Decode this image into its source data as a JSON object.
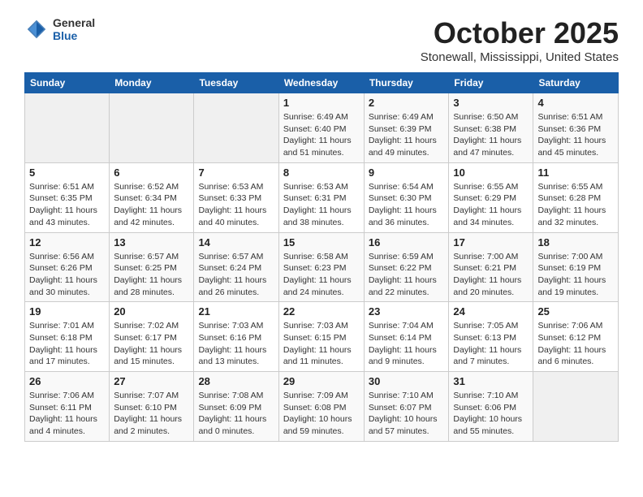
{
  "header": {
    "logo": {
      "general": "General",
      "blue": "Blue"
    },
    "title": "October 2025",
    "location": "Stonewall, Mississippi, United States"
  },
  "weekdays": [
    "Sunday",
    "Monday",
    "Tuesday",
    "Wednesday",
    "Thursday",
    "Friday",
    "Saturday"
  ],
  "weeks": [
    [
      {
        "day": "",
        "info": ""
      },
      {
        "day": "",
        "info": ""
      },
      {
        "day": "",
        "info": ""
      },
      {
        "day": "1",
        "info": "Sunrise: 6:49 AM\nSunset: 6:40 PM\nDaylight: 11 hours and 51 minutes."
      },
      {
        "day": "2",
        "info": "Sunrise: 6:49 AM\nSunset: 6:39 PM\nDaylight: 11 hours and 49 minutes."
      },
      {
        "day": "3",
        "info": "Sunrise: 6:50 AM\nSunset: 6:38 PM\nDaylight: 11 hours and 47 minutes."
      },
      {
        "day": "4",
        "info": "Sunrise: 6:51 AM\nSunset: 6:36 PM\nDaylight: 11 hours and 45 minutes."
      }
    ],
    [
      {
        "day": "5",
        "info": "Sunrise: 6:51 AM\nSunset: 6:35 PM\nDaylight: 11 hours and 43 minutes."
      },
      {
        "day": "6",
        "info": "Sunrise: 6:52 AM\nSunset: 6:34 PM\nDaylight: 11 hours and 42 minutes."
      },
      {
        "day": "7",
        "info": "Sunrise: 6:53 AM\nSunset: 6:33 PM\nDaylight: 11 hours and 40 minutes."
      },
      {
        "day": "8",
        "info": "Sunrise: 6:53 AM\nSunset: 6:31 PM\nDaylight: 11 hours and 38 minutes."
      },
      {
        "day": "9",
        "info": "Sunrise: 6:54 AM\nSunset: 6:30 PM\nDaylight: 11 hours and 36 minutes."
      },
      {
        "day": "10",
        "info": "Sunrise: 6:55 AM\nSunset: 6:29 PM\nDaylight: 11 hours and 34 minutes."
      },
      {
        "day": "11",
        "info": "Sunrise: 6:55 AM\nSunset: 6:28 PM\nDaylight: 11 hours and 32 minutes."
      }
    ],
    [
      {
        "day": "12",
        "info": "Sunrise: 6:56 AM\nSunset: 6:26 PM\nDaylight: 11 hours and 30 minutes."
      },
      {
        "day": "13",
        "info": "Sunrise: 6:57 AM\nSunset: 6:25 PM\nDaylight: 11 hours and 28 minutes."
      },
      {
        "day": "14",
        "info": "Sunrise: 6:57 AM\nSunset: 6:24 PM\nDaylight: 11 hours and 26 minutes."
      },
      {
        "day": "15",
        "info": "Sunrise: 6:58 AM\nSunset: 6:23 PM\nDaylight: 11 hours and 24 minutes."
      },
      {
        "day": "16",
        "info": "Sunrise: 6:59 AM\nSunset: 6:22 PM\nDaylight: 11 hours and 22 minutes."
      },
      {
        "day": "17",
        "info": "Sunrise: 7:00 AM\nSunset: 6:21 PM\nDaylight: 11 hours and 20 minutes."
      },
      {
        "day": "18",
        "info": "Sunrise: 7:00 AM\nSunset: 6:19 PM\nDaylight: 11 hours and 19 minutes."
      }
    ],
    [
      {
        "day": "19",
        "info": "Sunrise: 7:01 AM\nSunset: 6:18 PM\nDaylight: 11 hours and 17 minutes."
      },
      {
        "day": "20",
        "info": "Sunrise: 7:02 AM\nSunset: 6:17 PM\nDaylight: 11 hours and 15 minutes."
      },
      {
        "day": "21",
        "info": "Sunrise: 7:03 AM\nSunset: 6:16 PM\nDaylight: 11 hours and 13 minutes."
      },
      {
        "day": "22",
        "info": "Sunrise: 7:03 AM\nSunset: 6:15 PM\nDaylight: 11 hours and 11 minutes."
      },
      {
        "day": "23",
        "info": "Sunrise: 7:04 AM\nSunset: 6:14 PM\nDaylight: 11 hours and 9 minutes."
      },
      {
        "day": "24",
        "info": "Sunrise: 7:05 AM\nSunset: 6:13 PM\nDaylight: 11 hours and 7 minutes."
      },
      {
        "day": "25",
        "info": "Sunrise: 7:06 AM\nSunset: 6:12 PM\nDaylight: 11 hours and 6 minutes."
      }
    ],
    [
      {
        "day": "26",
        "info": "Sunrise: 7:06 AM\nSunset: 6:11 PM\nDaylight: 11 hours and 4 minutes."
      },
      {
        "day": "27",
        "info": "Sunrise: 7:07 AM\nSunset: 6:10 PM\nDaylight: 11 hours and 2 minutes."
      },
      {
        "day": "28",
        "info": "Sunrise: 7:08 AM\nSunset: 6:09 PM\nDaylight: 11 hours and 0 minutes."
      },
      {
        "day": "29",
        "info": "Sunrise: 7:09 AM\nSunset: 6:08 PM\nDaylight: 10 hours and 59 minutes."
      },
      {
        "day": "30",
        "info": "Sunrise: 7:10 AM\nSunset: 6:07 PM\nDaylight: 10 hours and 57 minutes."
      },
      {
        "day": "31",
        "info": "Sunrise: 7:10 AM\nSunset: 6:06 PM\nDaylight: 10 hours and 55 minutes."
      },
      {
        "day": "",
        "info": ""
      }
    ]
  ]
}
